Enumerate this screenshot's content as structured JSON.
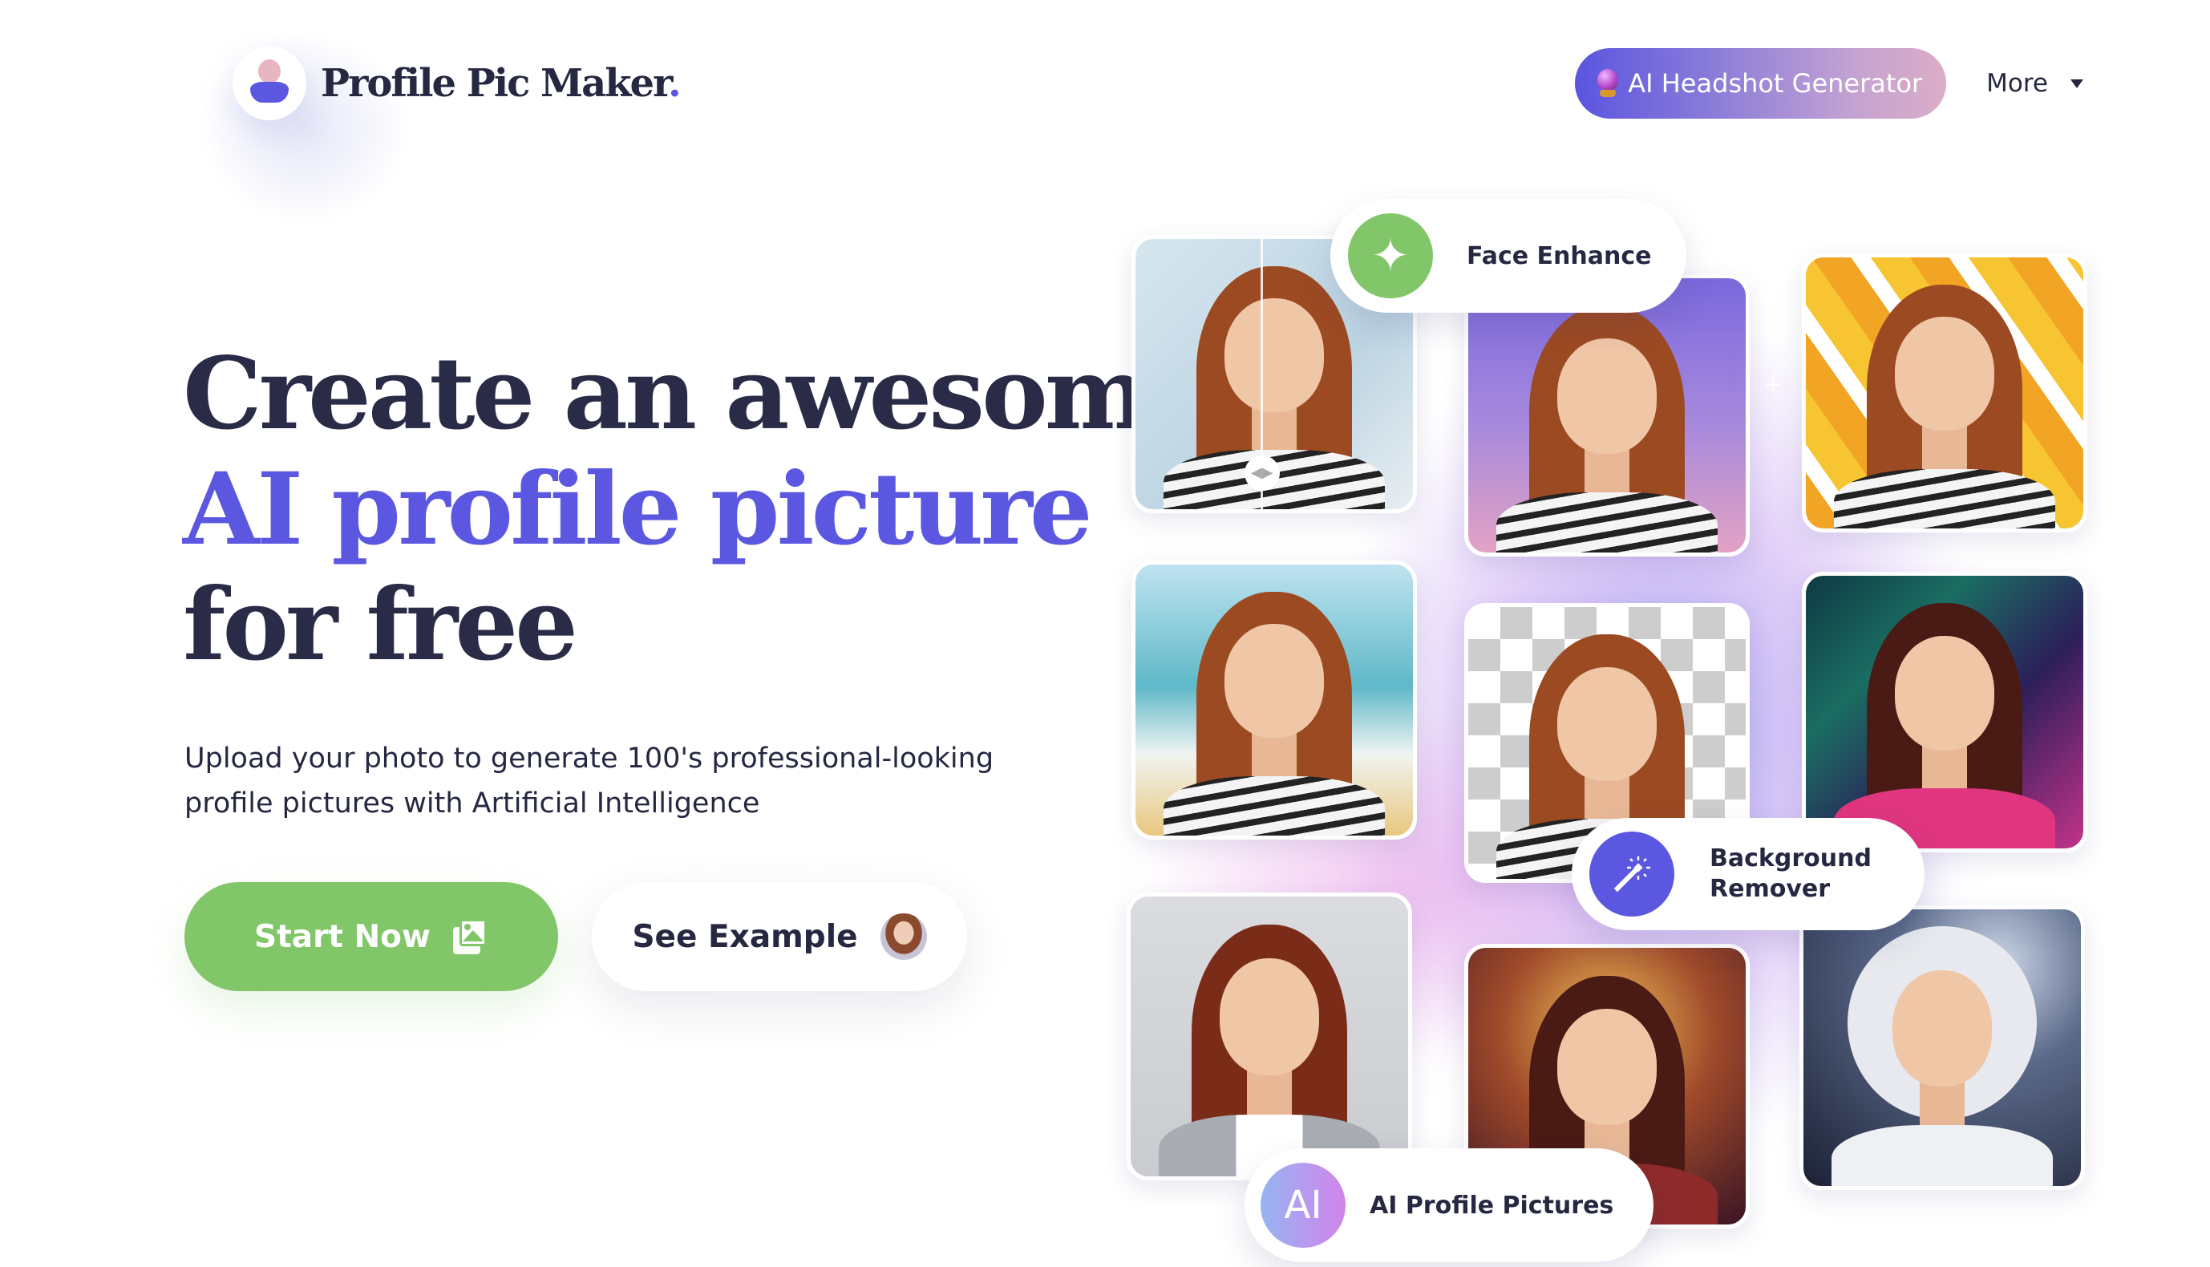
{
  "header": {
    "logo_text": "Profile Pic Maker",
    "logo_dot": ".",
    "nav": {
      "headshot_button": "AI Headshot Generator",
      "more_label": "More"
    }
  },
  "hero": {
    "headline_line1": "Create an awesome",
    "headline_line2": "AI profile picture",
    "headline_line3": "for free",
    "subtitle": "Upload your photo to generate 100's professional-looking profile pictures with Artificial Intelligence",
    "start_button": "Start Now",
    "example_button": "See Example"
  },
  "collage": {
    "badges": {
      "face_enhance": "Face Enhance",
      "background_remover": "Background Remover",
      "ai_profile_pictures": "AI Profile Pictures",
      "ai_icon_text": "AI"
    },
    "cards": [
      {
        "style": "face-enhance-before-after"
      },
      {
        "style": "purple-gradient-background"
      },
      {
        "style": "yellow-pattern-background"
      },
      {
        "style": "beach-background"
      },
      {
        "style": "transparent-background"
      },
      {
        "style": "neon-headphones"
      },
      {
        "style": "business-suit"
      },
      {
        "style": "superhero"
      },
      {
        "style": "astronaut"
      }
    ]
  },
  "colors": {
    "accent_purple": "#5b57e0",
    "cta_green": "#82c66a",
    "text_dark": "#262842"
  }
}
